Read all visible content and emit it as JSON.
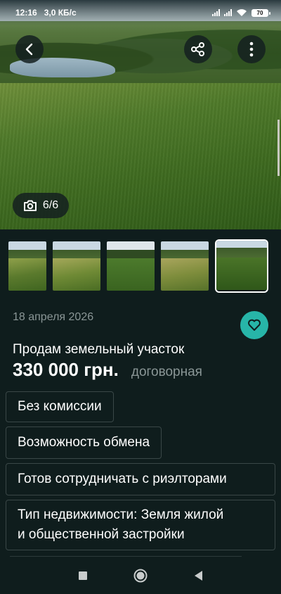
{
  "status_bar": {
    "time": "12:16",
    "speed": "3,0 КБ/с",
    "battery": "70"
  },
  "gallery": {
    "counter": "6/6",
    "current": 6,
    "total": 6,
    "icons": {
      "back": "arrow-left-icon",
      "share": "share-icon",
      "more": "more-vertical-icon",
      "camera": "camera-icon"
    }
  },
  "listing": {
    "date": "18 апреля 2026",
    "title": "Продам земельный участок",
    "price": "330 000 грн.",
    "negotiable": "договорная",
    "tags": [
      "Без комиссии",
      "Возможность обмена",
      "Готов сотрудничать с риэлторами",
      "Тип недвижимости: Земля жилой и общественной застройки"
    ],
    "tag4_line1": "Тип недвижимости: Земля жилой",
    "tag4_line2": "и общественной застройки"
  },
  "colors": {
    "background": "#0f1d1d",
    "accent": "#27b5a8",
    "muted_text": "#8a9696"
  }
}
